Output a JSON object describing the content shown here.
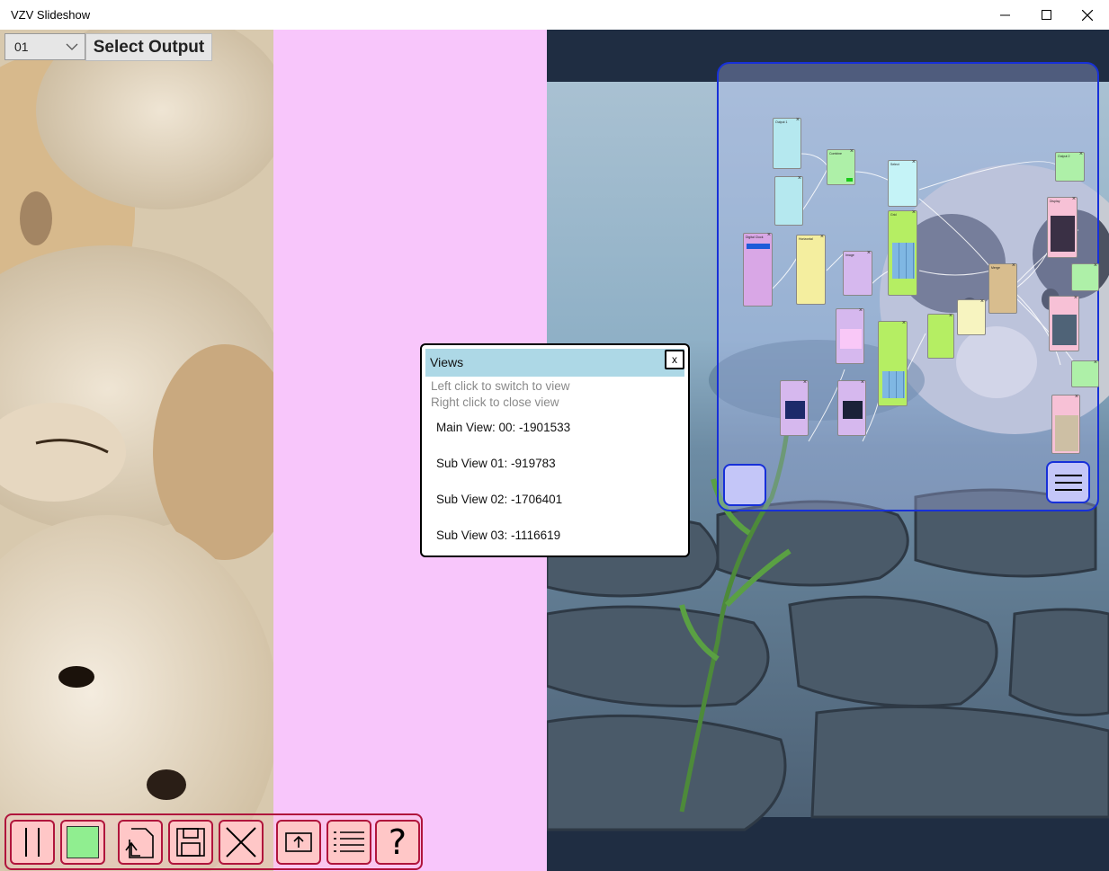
{
  "window": {
    "title": "VZV Slideshow",
    "minimize_glyph": "—",
    "maximize_glyph": "☐",
    "close_glyph": "✕"
  },
  "output_select": {
    "value": "01",
    "button_label": "Select Output"
  },
  "views_panel": {
    "title": "Views",
    "close_label": "x",
    "hint_line1": "Left click to switch to view",
    "hint_line2": "Right click to close view",
    "items": [
      "Main View: 00: -1901533",
      "Sub View 01: -919783",
      "Sub View 02: -1706401",
      "Sub View 03: -1116619"
    ]
  },
  "toolbar": {
    "buttons": [
      {
        "name": "pause-button",
        "icon": "pause-icon"
      },
      {
        "name": "color-button",
        "icon": "green-square-icon",
        "color": "#90ee90"
      },
      {
        "name": "open-folder-button",
        "icon": "open-icon"
      },
      {
        "name": "save-button",
        "icon": "save-icon"
      },
      {
        "name": "clear-button",
        "icon": "close-icon"
      },
      {
        "name": "output-button",
        "icon": "share-screen-icon"
      },
      {
        "name": "list-button",
        "icon": "list-icon"
      },
      {
        "name": "help-button",
        "icon": "help-icon",
        "label": "?"
      }
    ]
  },
  "node_graph": {
    "nodes": [
      {
        "label": "Output 1",
        "color": "#b5e8ef"
      },
      {
        "label": "Combine",
        "color": "#aef0a8"
      },
      {
        "label": "Select",
        "color": "#c5f3f7"
      },
      {
        "label": "Output 2",
        "color": "#aef0a8"
      },
      {
        "label": "Digital Clock",
        "color": "#d9a7e6"
      },
      {
        "label": "Horizontal",
        "color": "#f4ee9f"
      },
      {
        "label": "Image",
        "color": "#d6b8ee"
      },
      {
        "label": "Grid",
        "color": "#b5ee63"
      },
      {
        "label": "Merge",
        "color": "#d8bd8e"
      },
      {
        "label": "Display",
        "color": "#f7c1d6"
      }
    ]
  },
  "colors": {
    "pink_panel": "#f8c6fb",
    "right_bg": "#1f2d42",
    "toolbar_border": "#b0153c",
    "toolbar_fill": "#ffc7c7",
    "overlay_border": "#1730d8",
    "views_header": "#add8e6"
  }
}
